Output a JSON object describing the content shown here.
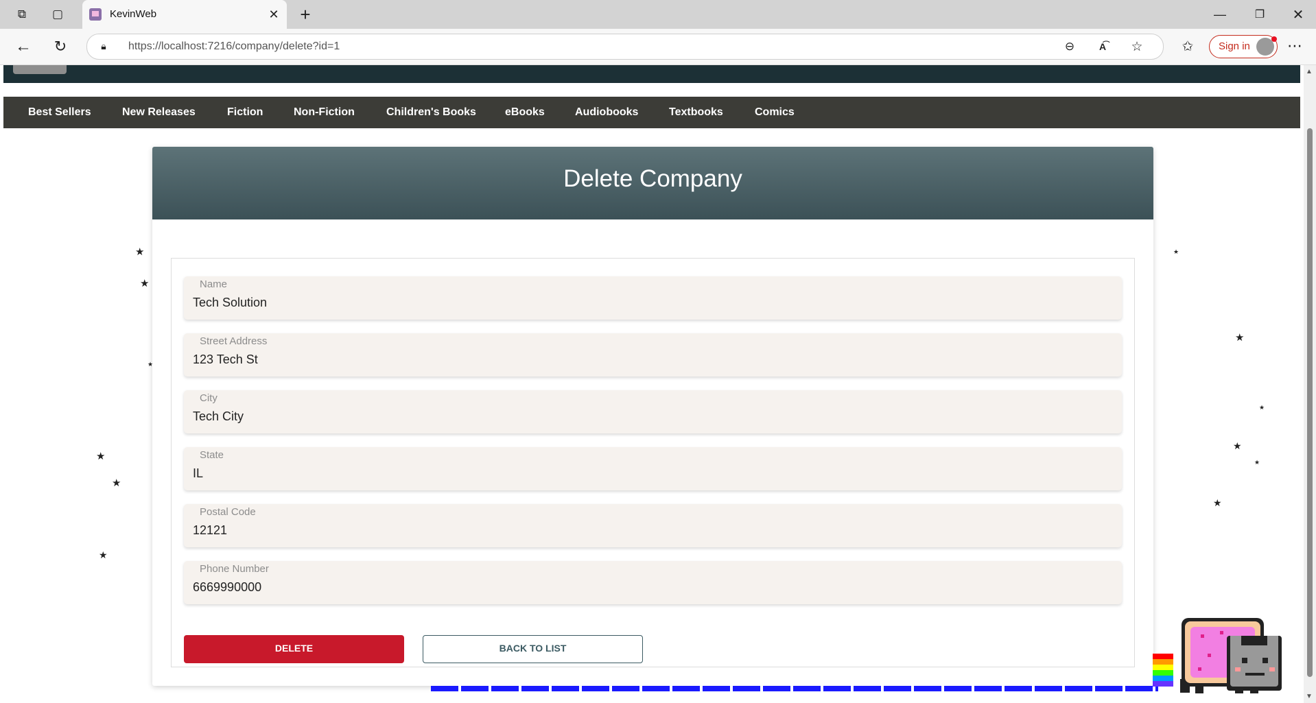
{
  "browser": {
    "tab_title": "KevinWeb",
    "url": "https://localhost:7216/company/delete?id=1",
    "signin_label": "Sign in"
  },
  "nav": {
    "items": [
      "Best Sellers",
      "New Releases",
      "Fiction",
      "Non-Fiction",
      "Children's Books",
      "eBooks",
      "Audiobooks",
      "Textbooks",
      "Comics"
    ]
  },
  "page": {
    "title": "Delete Company",
    "fields": [
      {
        "label": "Name",
        "value": "Tech Solution"
      },
      {
        "label": "Street Address",
        "value": "123 Tech St"
      },
      {
        "label": "City",
        "value": "Tech City"
      },
      {
        "label": "State",
        "value": "IL"
      },
      {
        "label": "Postal Code",
        "value": "12121"
      },
      {
        "label": "Phone Number",
        "value": "6669990000"
      }
    ],
    "delete_label": "DELETE",
    "back_label": "BACK TO LIST"
  },
  "colors": {
    "delete": "#c8192b",
    "header": "#1c3036",
    "nav": "#3c3c37"
  }
}
